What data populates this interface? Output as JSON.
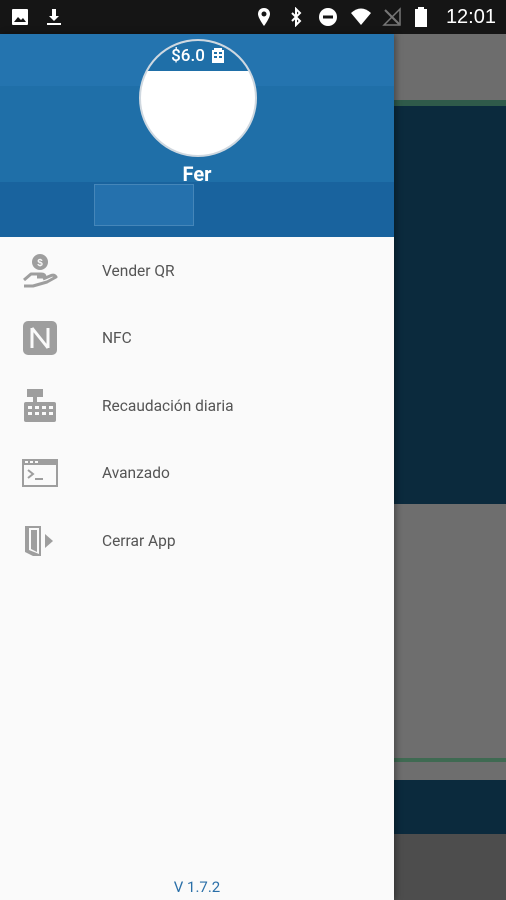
{
  "status_bar": {
    "time": "12:01",
    "left_icons": [
      "image-icon",
      "download-icon"
    ],
    "right_icons": [
      "location-icon",
      "bluetooth-icon",
      "do-not-disturb-icon",
      "wifi-icon",
      "no-signal-icon",
      "battery-icon"
    ]
  },
  "drawer": {
    "balance": "$6.0",
    "user_name": "Fer",
    "items": [
      {
        "label": "Vender QR",
        "icon": "hand-coin-icon"
      },
      {
        "label": "NFC",
        "icon": "nfc-icon"
      },
      {
        "label": "Recaudación diaria",
        "icon": "cash-register-icon"
      },
      {
        "label": "Avanzado",
        "icon": "terminal-icon"
      },
      {
        "label": "Cerrar App",
        "icon": "exit-door-icon"
      }
    ],
    "version": "V 1.7.2"
  },
  "colors": {
    "header": "#1f6fa8",
    "accent": "#2a6fa8",
    "icon_gray": "#9e9e9e"
  }
}
